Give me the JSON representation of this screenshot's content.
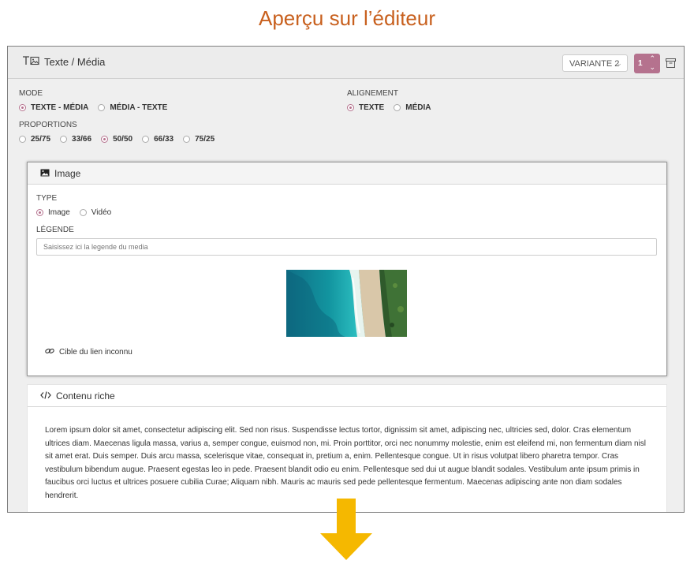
{
  "page_heading": "Aperçu sur l’éditeur",
  "block": {
    "title": "Texte / Média",
    "variant": "VARIANTE 2",
    "index": "1"
  },
  "mode": {
    "label": "MODE",
    "options": [
      "TEXTE - MÉDIA",
      "MÉDIA - TEXTE"
    ],
    "selected": "TEXTE - MÉDIA"
  },
  "alignement": {
    "label": "ALIGNEMENT",
    "options": [
      "TEXTE",
      "MÉDIA"
    ],
    "selected": "TEXTE"
  },
  "proportions": {
    "label": "PROPORTIONS",
    "options": [
      "25/75",
      "33/66",
      "50/50",
      "66/33",
      "75/25"
    ],
    "selected": "50/50"
  },
  "image_card": {
    "title": "Image",
    "type_label": "TYPE",
    "type_options": [
      "Image",
      "Vidéo"
    ],
    "type_selected": "Image",
    "legend_label": "LÉGENDE",
    "legend_placeholder": "Saisissez ici la legende du media",
    "link_text": "Cible du lien inconnu"
  },
  "rich_card": {
    "title": "Contenu riche",
    "text": "Lorem ipsum dolor sit amet, consectetur adipiscing elit. Sed non risus. Suspendisse lectus tortor, dignissim sit amet, adipiscing nec, ultricies sed, dolor. Cras elementum ultrices diam. Maecenas ligula massa, varius a, semper congue, euismod non, mi. Proin porttitor, orci nec nonummy molestie, enim est eleifend mi, non fermentum diam nisl sit amet erat. Duis semper. Duis arcu massa, scelerisque vitae, consequat in, pretium a, enim. Pellentesque congue. Ut in risus volutpat libero pharetra tempor. Cras vestibulum bibendum augue. Praesent egestas leo in pede. Praesent blandit odio eu enim. Pellentesque sed dui ut augue blandit sodales. Vestibulum ante ipsum primis in faucibus orci luctus et ultrices posuere cubilia Curae; Aliquam nibh. Mauris ac mauris sed pede pellentesque fermentum. Maecenas adipiscing ante non diam sodales hendrerit."
  },
  "colors": {
    "heading": "#c8601e",
    "accent": "#b5728e",
    "arrow": "#f5b800"
  }
}
